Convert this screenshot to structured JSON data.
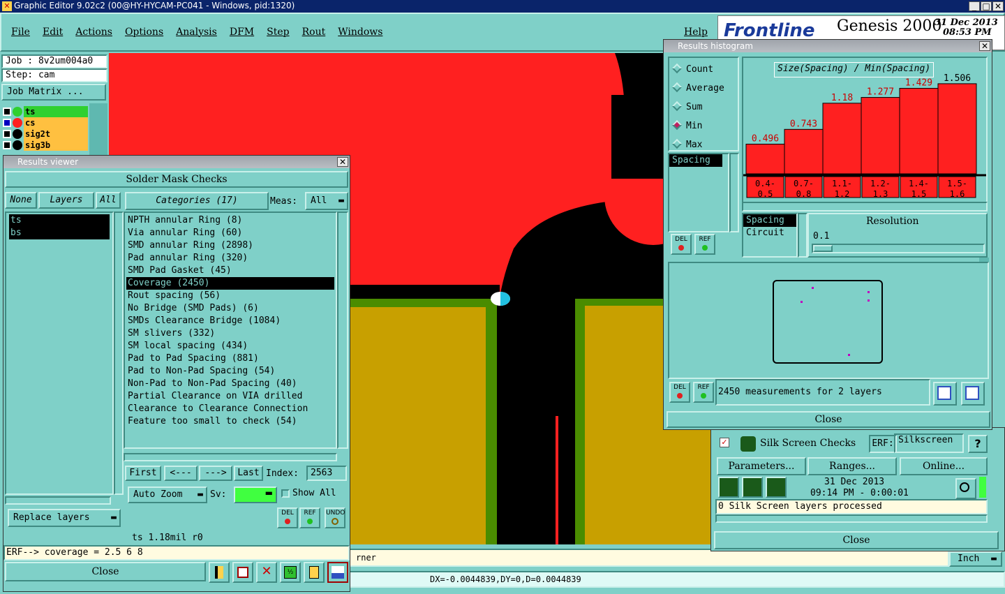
{
  "app": {
    "title": "Graphic Editor 9.02c2 (00@HY-HYCAM-PC041 - Windows, pid:1320)",
    "menu": [
      "File",
      "Edit",
      "Actions",
      "Options",
      "Analysis",
      "DFM",
      "Step",
      "Rout",
      "Windows"
    ],
    "help": "Help",
    "brand": "Frontline",
    "product": "Genesis 2000",
    "date": "31 Dec 2013",
    "time": "08:53 PM",
    "job": "Job : 8v2um004a0",
    "step": "Step: cam",
    "job_matrix": "Job Matrix ...",
    "layers": [
      {
        "name": "ts",
        "color": "#30d030"
      },
      {
        "name": "cs",
        "color": "#ff2020"
      },
      {
        "name": "sig2t",
        "color": ""
      },
      {
        "name": "sig3b",
        "color": ""
      }
    ],
    "corner_text": "rner",
    "units": "Inch",
    "coords": "DX=-0.0044839,DY=0,D=0.0044839"
  },
  "results_viewer": {
    "title": "Results viewer",
    "header": "Solder Mask Checks",
    "none": "None",
    "layers_label": "Layers",
    "all": "All",
    "layer_list": [
      "ts",
      "bs"
    ],
    "categories_label": "Categories (17)",
    "meas_label": "Meas:",
    "meas_value": "All",
    "categories": [
      "NPTH annular Ring (8)",
      "Via annular Ring (60)",
      "SMD annular Ring (2898)",
      "Pad annular Ring (320)",
      "SMD Pad Gasket (45)",
      "Coverage (2450)",
      "Rout spacing (56)",
      "No Bridge (SMD Pads) (6)",
      "SMDs Clearance Bridge (1084)",
      "SM slivers (332)",
      "SM local spacing (434)",
      "Pad to Pad Spacing (881)",
      "Pad to Non-Pad Spacing (54)",
      "Non-Pad to Non-Pad Spacing (40)",
      "Partial Clearance on VIA drilled",
      "Clearance to Clearance Connection",
      "Feature too small to check (54)"
    ],
    "selected_category": 5,
    "first": "First",
    "prev": "<---",
    "next": "--->",
    "last": "Last",
    "index_label": "Index:",
    "index_value": "2563",
    "auto_zoom": "Auto Zoom",
    "sv_label": "Sv:",
    "show_all": "Show All",
    "replace_layers": "Replace layers",
    "del": "DEL",
    "ref": "REF",
    "undo": "UNDO",
    "status": "ts 1.18mil  r0",
    "erf": "ERF--> coverage = 2.5 6 8",
    "close": "Close"
  },
  "histogram": {
    "title": "Results histogram",
    "modes": [
      "Count",
      "Average",
      "Sum",
      "Min",
      "Max"
    ],
    "selected_mode": "Min",
    "chart_title": "Size(Spacing) / Min(Spacing)",
    "list": [
      "Spacing"
    ],
    "sub_list": [
      "Spacing",
      "Circuit"
    ],
    "resolution_label": "Resolution",
    "resolution_value": "0.1",
    "measurements": "2450 measurements for 2 layers",
    "close": "Close",
    "del": "DEL",
    "ref": "REF"
  },
  "chart_data": {
    "type": "bar",
    "title": "Size(Spacing) / Min(Spacing)",
    "categories": [
      "0.4-\n0.5",
      "0.7-\n0.8",
      "1.1-\n1.2",
      "1.2-\n1.3",
      "1.4-\n1.5",
      "1.5-\n1.6"
    ],
    "values": [
      0.496,
      0.743,
      1.18,
      1.277,
      1.429,
      1.506
    ],
    "value_labels": [
      "0.496",
      "0.743",
      "1.18",
      "1.277",
      "1.429",
      "1.506"
    ],
    "label_colors": [
      "#cc0000",
      "#cc0000",
      "#cc0000",
      "#cc0000",
      "#cc0000",
      "#000000"
    ],
    "bar_color": "#ff2020",
    "ylim": [
      0,
      1.75
    ]
  },
  "silk": {
    "title": "Silk Screen Checks",
    "erf": "ERF:",
    "erf_value": "Silkscreen",
    "help": "?",
    "parameters": "Parameters...",
    "ranges": "Ranges...",
    "online": "Online...",
    "date": "31 Dec 2013",
    "time": "09:14 PM - 0:00:01",
    "status": "0 Silk Screen layers processed",
    "close": "Close"
  }
}
